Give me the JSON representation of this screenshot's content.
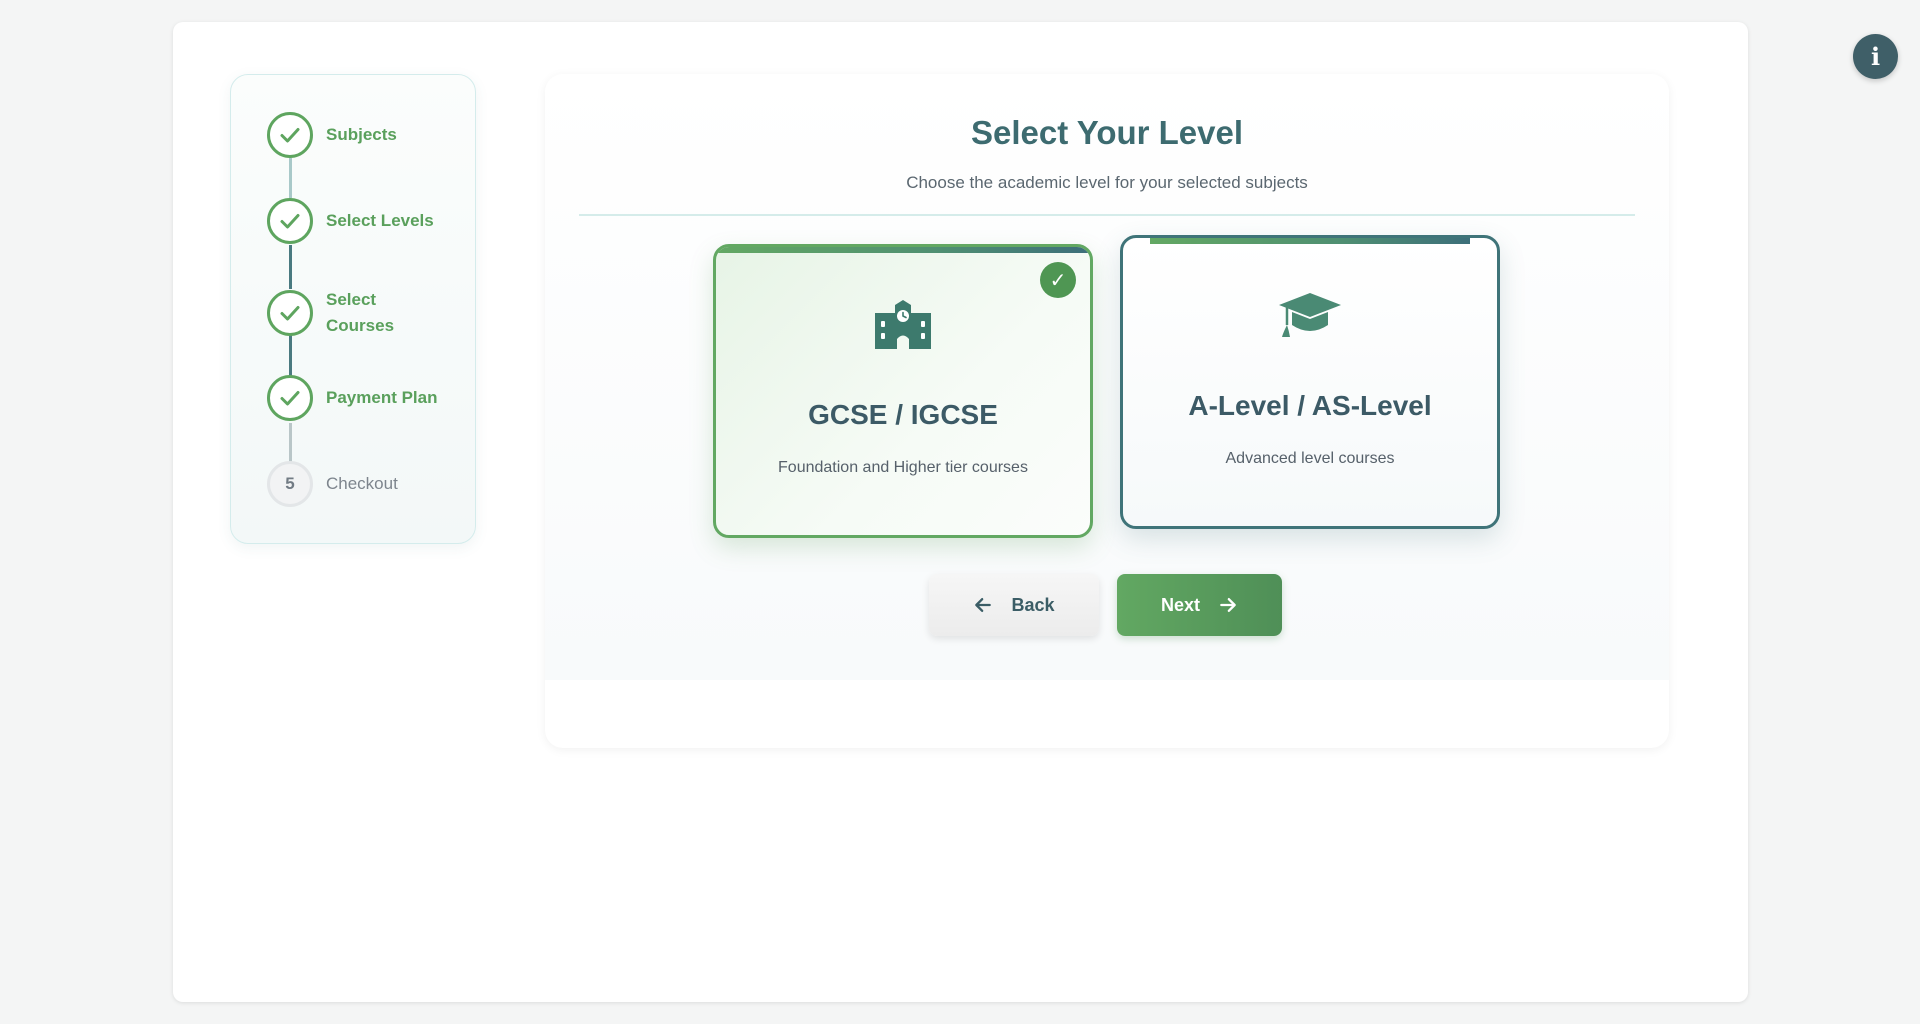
{
  "stepper": {
    "steps": [
      {
        "label": "Subjects",
        "status": "complete"
      },
      {
        "label": "Select Levels",
        "status": "complete"
      },
      {
        "label": "Select Courses",
        "status": "complete"
      },
      {
        "label": "Payment Plan",
        "status": "complete"
      },
      {
        "label": "Checkout",
        "status": "pending",
        "number": "5"
      }
    ]
  },
  "main": {
    "title": "Select Your Level",
    "subtitle": "Choose the academic level for your selected subjects",
    "levels": [
      {
        "title": "GCSE / IGCSE",
        "description": "Foundation and Higher tier courses",
        "icon": "school-icon",
        "selected": true,
        "badge": "✓"
      },
      {
        "title": "A-Level / AS-Level",
        "description": "Advanced level courses",
        "icon": "graduation-cap-icon",
        "selected": false
      }
    ],
    "back_label": "Back",
    "next_label": "Next"
  },
  "info_button": {
    "label": "i"
  },
  "colors": {
    "accent_green": "#5ea55f",
    "accent_teal": "#3f7479",
    "title": "#3d6b70",
    "info_bg": "#3f5f68"
  }
}
